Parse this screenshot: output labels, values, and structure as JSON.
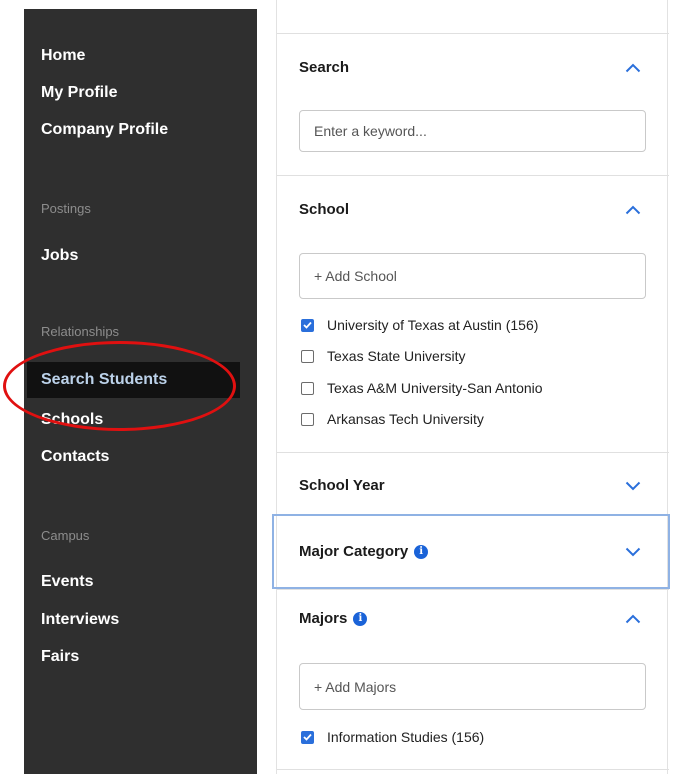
{
  "sidebar": {
    "items": [
      {
        "label": "Home"
      },
      {
        "label": "My Profile"
      },
      {
        "label": "Company Profile"
      }
    ],
    "postings": {
      "section_label": "Postings",
      "items": [
        {
          "label": "Jobs"
        }
      ]
    },
    "relationships": {
      "section_label": "Relationships",
      "items": [
        {
          "label": "Search Students"
        },
        {
          "label": "Schools"
        },
        {
          "label": "Contacts"
        }
      ]
    },
    "campus": {
      "section_label": "Campus",
      "items": [
        {
          "label": "Events"
        },
        {
          "label": "Interviews"
        },
        {
          "label": "Fairs"
        }
      ]
    },
    "active_item": "Search Students"
  },
  "filters": {
    "search": {
      "title": "Search",
      "placeholder": "Enter a keyword...",
      "expanded": true
    },
    "school": {
      "title": "School",
      "placeholder": "+ Add School",
      "expanded": true,
      "options": [
        {
          "label": "University of Texas at Austin (156)",
          "checked": true
        },
        {
          "label": "Texas State University",
          "checked": false
        },
        {
          "label": "Texas A&M University-San Antonio",
          "checked": false
        },
        {
          "label": "Arkansas Tech University",
          "checked": false
        }
      ]
    },
    "school_year": {
      "title": "School Year",
      "expanded": false
    },
    "major_category": {
      "title": "Major Category",
      "expanded": false,
      "info_icon": "info-icon"
    },
    "majors": {
      "title": "Majors",
      "placeholder": "+ Add Majors",
      "expanded": true,
      "info_icon": "info-icon",
      "options": [
        {
          "label": "Information Studies (156)",
          "checked": true
        }
      ]
    }
  },
  "colors": {
    "accent": "#2a6fdb",
    "sidebar_bg": "#2f2f2f",
    "highlight": "#e01010",
    "focus": "#8fb2e4"
  }
}
